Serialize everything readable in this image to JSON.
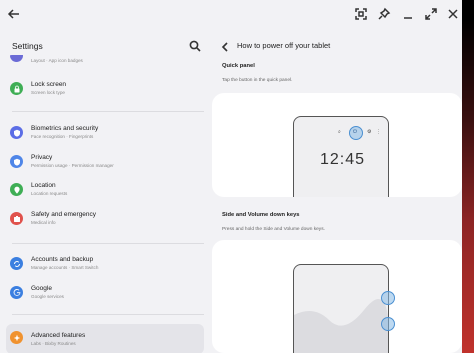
{
  "window": {
    "back_icon": "arrow-left-icon",
    "controls": [
      "screenshot-icon",
      "pin-icon",
      "minimize-icon",
      "maximize-icon",
      "close-icon"
    ]
  },
  "settings": {
    "title": "Settings",
    "top_partial": {
      "title": "Layout",
      "subtitle": "Layout · App icon badges"
    },
    "items": [
      {
        "title": "Lock screen",
        "subtitle": "Screen lock type",
        "color": "#3fae55",
        "icon": "lock-icon"
      },
      {
        "title": "Biometrics and security",
        "subtitle": "Face recognition · Fingerprints",
        "color": "#5c6ee6",
        "icon": "shield-icon"
      },
      {
        "title": "Privacy",
        "subtitle": "Permission usage · Permission manager",
        "color": "#4f86e8",
        "icon": "privacy-icon"
      },
      {
        "title": "Location",
        "subtitle": "Location requests",
        "color": "#3fae55",
        "icon": "location-icon"
      },
      {
        "title": "Safety and emergency",
        "subtitle": "Medical info",
        "color": "#e0524c",
        "icon": "emergency-icon"
      },
      {
        "title": "Accounts and backup",
        "subtitle": "Manage accounts · Smart Switch",
        "color": "#3b7fe0",
        "icon": "sync-icon"
      },
      {
        "title": "Google",
        "subtitle": "Google services",
        "color": "#3b7fe0",
        "icon": "google-icon"
      },
      {
        "title": "Advanced features",
        "subtitle": "Labs · Bixby Routines",
        "color": "#f0922f",
        "icon": "advanced-features-icon"
      }
    ]
  },
  "guide": {
    "title": "How to power off your tablet",
    "sections": [
      {
        "heading": "Quick panel",
        "description": "Tap the button in the quick panel."
      },
      {
        "heading": "Side and Volume down keys",
        "description": "Press and hold the Side and Volume down keys."
      }
    ],
    "clock": "12:45"
  }
}
